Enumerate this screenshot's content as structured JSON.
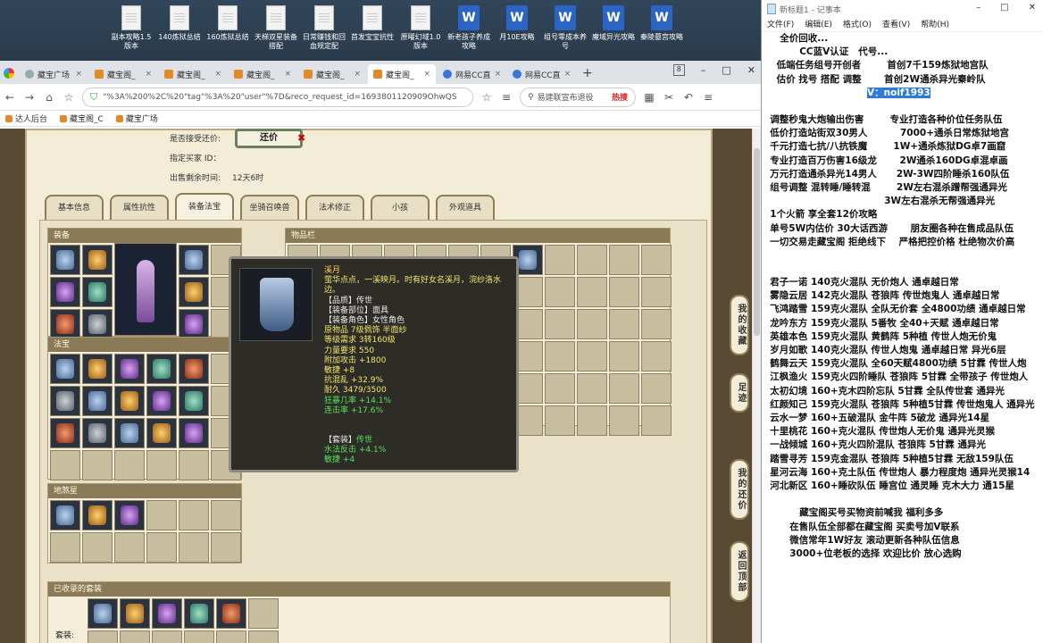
{
  "desktop": {
    "icons": [
      {
        "label": "副本攻略1.5版本",
        "type": "doc"
      },
      {
        "label": "140炼狱总结",
        "type": "doc"
      },
      {
        "label": "160炼狱总结",
        "type": "doc"
      },
      {
        "label": "天梯双星装备搭配",
        "type": "doc"
      },
      {
        "label": "日常赚钱和回血规定配",
        "type": "doc"
      },
      {
        "label": "首发宝宝抗性",
        "type": "doc"
      },
      {
        "label": "原曜幻域1.0版本",
        "type": "doc"
      },
      {
        "label": "新老孩子养成攻略",
        "type": "word"
      },
      {
        "label": "月10E攻略",
        "type": "word"
      },
      {
        "label": "组号零成本养号",
        "type": "word"
      },
      {
        "label": "魔域异光攻略",
        "type": "word"
      },
      {
        "label": "秦陵墓宫攻略",
        "type": "word"
      }
    ]
  },
  "browser": {
    "tabs": [
      {
        "label": "藏宝广场",
        "active": false,
        "fav": "g"
      },
      {
        "label": "藏宝阁_",
        "active": false,
        "fav": "o"
      },
      {
        "label": "藏宝阁_",
        "active": false,
        "fav": "o"
      },
      {
        "label": "藏宝阁_",
        "active": false,
        "fav": "o"
      },
      {
        "label": "藏宝阁_",
        "active": false,
        "fav": "o"
      },
      {
        "label": "藏宝阁_",
        "active": true,
        "fav": "o"
      },
      {
        "label": "网易CC直",
        "active": false,
        "fav": "b"
      },
      {
        "label": "网易CC直",
        "active": false,
        "fav": "b"
      }
    ],
    "tab_badge": "8",
    "address": "\"%3A%200%2C%20\"tag\"%3A%20\"user\"%7D&reco_request_id=1693801120909OhwQS",
    "search_placeholder": "易建联宣布退役",
    "search_hot": "热搜",
    "bookmarks": [
      "达人后台",
      "藏宝阁_C",
      "藏宝广场"
    ]
  },
  "listing": {
    "haggle_label": "是否接受还价:",
    "haggle_button": "还价",
    "buyer_label": "指定买家 ID：",
    "remaining_label": "出售剩余时间:",
    "remaining_value": "12天6时"
  },
  "game_tabs": [
    "基本信息",
    "属性抗性",
    "装备法宝",
    "坐骑召唤兽",
    "法术修正",
    "小孩",
    "外观道具"
  ],
  "active_game_tab": 2,
  "sections": {
    "equipment": "装备",
    "fabao": "法宝",
    "fabao2": "地煞星",
    "inventory": "物品栏",
    "sets": "已收录的套装",
    "sets_label": "套装:"
  },
  "tooltip": {
    "name": "溪月",
    "desc": "萤华点点，一溪映月。时有好女名溪月，浣纱洛水边。",
    "quality": "【品质】传世",
    "part": "【装备部位】面具",
    "role": "【装备角色】女性角色",
    "material": "原物品 7级佩饰 半面纱",
    "level": "等级需求 3转160级",
    "strength": "力量要求 550",
    "attack": "附加攻击 +1800",
    "agility": "敏捷 +8",
    "resist": "抗混乱 +32.9%",
    "durability": "耐久 3479/3500",
    "crit_mult": "狂暴几率 +14.1%",
    "crit_rate": "连击率 +17.6%",
    "set_title": "【套装】",
    "set_name": "传世",
    "set_bonus1": "水法反击 +4.1%",
    "set_bonus2": "敏捷 +4"
  },
  "side_buttons": [
    "我的收藏",
    "足迹",
    "我的还价",
    "返回顶部"
  ],
  "notepad": {
    "title": "新标题1 - 记事本",
    "menu": [
      "文件(F)",
      "编辑(E)",
      "格式(O)",
      "查看(V)",
      "帮助(H)"
    ],
    "header_lines": [
      "     全价回收...",
      "           CC蓝V认证   代号...",
      "    低端任务组号开创者        首创7千159炼狱地宫队",
      "    估价 找号 搭配 调整       首创2W通杀异光秦岭队"
    ],
    "contact": "V：noif1993",
    "lines": [
      "",
      "  调整秒鬼大炮输出伤害        专业打造各种价位任务队伍",
      "  低价打造站街双30男人          7000+通杀日常炼狱地宫",
      "  千元打造七抗/八抗铁魔        1W+通杀炼狱DG卓7画窟",
      "  专业打造百万伤害16级龙       2W通杀160DG卓混卓画",
      "  万元打造通杀异光14男人      2W-3W四阶睡杀160队伍",
      "  组号调整 混转睡/睡转混        2W左右混杀蹭帮强通异光",
      "                                     3W左右混杀无帮强通异光",
      "  1个火箭 享全套12价攻略",
      "  单号5W内估价 30大话西游       朋友圈各种在售成品队伍",
      "  一切交易走藏宝阁 拒绝线下    严格把控价格 杜绝物次价高",
      "",
      "",
      "  君子一诺 140克火混队 无价炮人 通卓越日常",
      "  雾隐云居 142克火混队 苍狼阵 传世炮鬼人 通卓越日常",
      "  飞鸿踏雪 159克火混队 全队无价套 全4800功绩 通卓越日常",
      "  龙吟东方 159克火混队 5番牧 全40+天赋 通卓越日常",
      "  英雄本色 159克火混队 黄鹤阵 5种植 传世人炮无价鬼",
      "  岁月如歌 140克火混队 传世人炮鬼 通卓越日常 异光6层",
      "  鹤舞云天 159克火混队 全60天赋4800功绩 5甘霖 传世人炮",
      "  江枫渔火 159克火四阶睡队 苍狼阵 5甘霖 全带孩子 传世炮人",
      "  太初幻境 160+克木四阶忘队 5甘霖 全队传世套 通异光",
      "  红颜知己 159克火混队 苍狼阵 5种植5甘霖 传世炮鬼人 通异光",
      "  云水一梦 160+五破混队 金牛阵 5破龙 通异光14星",
      "  十里桃花 160+克火混队 传世炮人无价鬼 通异光灵猴",
      "  一战倾城 160+克火四阶混队 苍狼阵 5甘霖 通异光",
      "  踏雪寻芳 159克金混队 苍狼阵 5种植5甘霖 无敌159队伍",
      "  星河云海 160+克土队伍 传世炮人 暴力程度炮 通异光灵猴14",
      "  河北新区 160+睡砍队伍 睡宫位 通灵睡 克木大力 通15星",
      "",
      "           藏宝阁买号买物资前喊我 福利多多",
      "        在售队伍全部都在藏宝阁 买卖号加V联系",
      "        微信常年1W好友 滚动更新各种队伍信息",
      "        3000+位老板的选择 欢迎比价 放心选购"
    ]
  }
}
